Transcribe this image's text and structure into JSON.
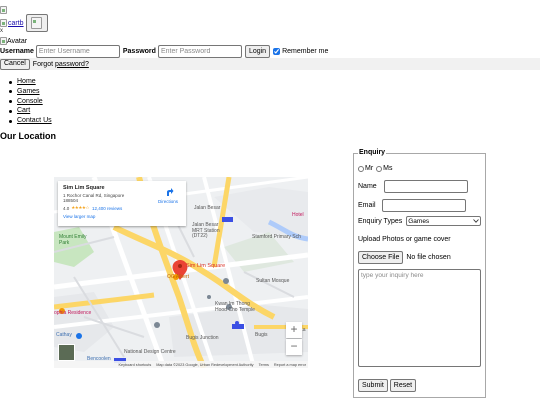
{
  "header": {
    "cart_link": "cartb",
    "close_mark": "x",
    "avatar_alt": "Avatar"
  },
  "login": {
    "username_label": "Username",
    "username_placeholder": "Enter Username",
    "password_label": "Password",
    "password_placeholder": "Enter Password",
    "login_button": "Login",
    "remember_label": "Remember me",
    "remember_checked": true,
    "cancel_button": "Cancel",
    "forgot_prefix": "Forgot",
    "forgot_link": "password?"
  },
  "nav": {
    "items": [
      "Home",
      "Games",
      "Console",
      "Cart",
      "Contact Us"
    ]
  },
  "section_title": "Our Location",
  "map": {
    "place_name": "Sim Lim Square",
    "address": "1 Rochor Canal Rd, Singapore 188504",
    "rating": "4.0",
    "stars": "★★★★☆",
    "reviews": "12,400 reviews",
    "larger_map": "View larger map",
    "directions": "Directions",
    "pin_label": "Sim Lim Square",
    "labels": {
      "jalan_besar": "Jalan Besar",
      "jalan_besar_mrt": "Jalan Besar MRT Station (DT22)",
      "mount_emily": "Mount Emily Park",
      "og_albert": "OG Albert",
      "stamford": "Stamford Primary Sch",
      "sultan_mosque": "Sultan Mosque",
      "kwan_im": "Kwan Im Thong Hood Cho Temple",
      "bugis_junction": "Bugis Junction",
      "bugis": "Bugis",
      "sophia": "ophia Residence",
      "cathay": "Cathay",
      "national_design": "National Design Centre",
      "bencoolen": "Bencoolen",
      "hotel": "Hotel",
      "haji": "Haji La"
    },
    "zoom_in": "+",
    "zoom_out": "−",
    "google": "Google",
    "footer": {
      "shortcuts": "Keyboard shortcuts",
      "data": "Map data ©2023 Google, Urban Redevelopment Authority",
      "terms": "Terms",
      "report": "Report a map error"
    }
  },
  "enquiry": {
    "legend": "Enquiry",
    "mr": "Mr",
    "ms": "Ms",
    "name_label": "Name",
    "email_label": "Email",
    "types_label": "Enquiry Types",
    "types_selected": "Games",
    "upload_label": "Upload Photos or game cover",
    "choose_file": "Choose File",
    "file_status": "No file chosen",
    "textarea_placeholder": "type your inquiry here",
    "submit": "Submit",
    "reset": "Reset"
  }
}
